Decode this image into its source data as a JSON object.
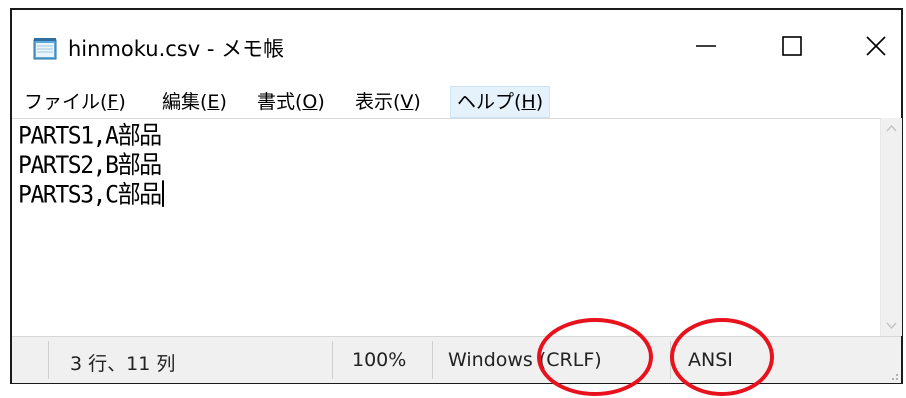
{
  "window": {
    "title": "hinmoku.csv - メモ帳",
    "icon": "notepad-icon",
    "controls": {
      "minimize_icon": "minimize-icon",
      "maximize_icon": "maximize-icon",
      "close_icon": "close-icon"
    }
  },
  "menu": {
    "items": [
      {
        "label": "ファイル(",
        "accel": "F",
        "suffix": ")"
      },
      {
        "label": "編集(",
        "accel": "E",
        "suffix": ")"
      },
      {
        "label": "書式(",
        "accel": "O",
        "suffix": ")"
      },
      {
        "label": "表示(",
        "accel": "V",
        "suffix": ")"
      },
      {
        "label": "ヘルプ(",
        "accel": "H",
        "suffix": ")",
        "active": true
      }
    ]
  },
  "editor": {
    "lines": [
      "PARTS1,A部品",
      "PARTS2,B部品",
      "PARTS3,C部品"
    ]
  },
  "statusbar": {
    "position": "3 行、11 列",
    "zoom": "100%",
    "line_ending": "Windows (CRLF)",
    "encoding": "ANSI"
  },
  "colors": {
    "annotation": "#e8121c",
    "menu_active_bg": "#e5f1fb",
    "statusbar_bg": "#f0f0f0"
  }
}
